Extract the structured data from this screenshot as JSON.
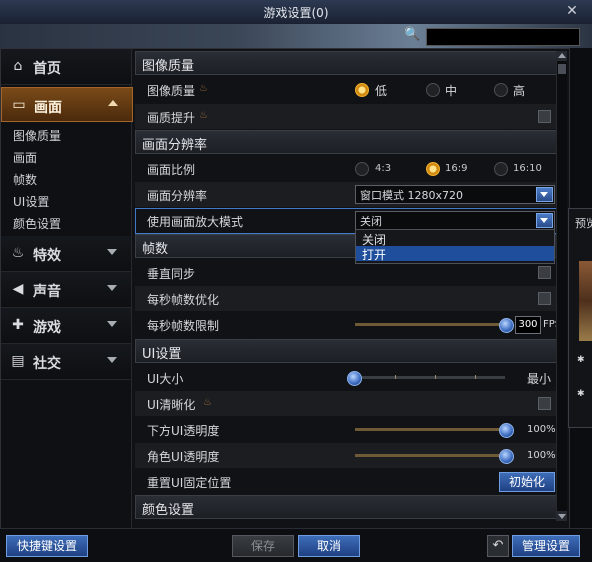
{
  "window": {
    "title": "游戏设置(0)",
    "close": "✕"
  },
  "sidebar": {
    "items": [
      {
        "label": "首页",
        "icon": "home-icon",
        "glyph": "⌂"
      },
      {
        "label": "画面",
        "icon": "monitor-icon",
        "glyph": "▭"
      },
      {
        "label": "特效",
        "icon": "flame-icon",
        "glyph": "♨"
      },
      {
        "label": "声音",
        "icon": "speaker-icon",
        "glyph": "◀"
      },
      {
        "label": "游戏",
        "icon": "gamepad-icon",
        "glyph": "✚"
      },
      {
        "label": "社交",
        "icon": "chat-icon",
        "glyph": "▤"
      }
    ],
    "subitems": [
      "图像质量",
      "画面",
      "帧数",
      "UI设置",
      "颜色设置"
    ]
  },
  "sections": {
    "image_quality": "图像质量",
    "resolution": "画面分辨率",
    "framerate": "帧数",
    "ui": "UI设置",
    "color": "颜色设置"
  },
  "rows": {
    "image_quality": {
      "label": "图像质量",
      "options": [
        "低",
        "中",
        "高"
      ],
      "selected": "低"
    },
    "quality_boost": {
      "label": "画质提升"
    },
    "aspect": {
      "label": "画面比例",
      "options": [
        "4:3",
        "16:9",
        "16:10"
      ],
      "selected": "16:9"
    },
    "resolution": {
      "label": "画面分辨率",
      "value": "窗口模式 1280x720"
    },
    "zoom_mode": {
      "label": "使用画面放大模式",
      "value": "关闭",
      "options": [
        "关闭",
        "打开"
      ],
      "highlighted": "打开"
    },
    "vsync": {
      "label": "垂直同步"
    },
    "fps_opt": {
      "label": "每秒帧数优化"
    },
    "fps_limit": {
      "label": "每秒帧数限制",
      "value": "300",
      "unit": "FPS",
      "level": 1.0
    },
    "ui_size": {
      "label": "UI大小",
      "value_label": "最小",
      "level": 0.0
    },
    "ui_sharpen": {
      "label": "UI清晰化"
    },
    "bottom_ui_opacity": {
      "label": "下方UI透明度",
      "value": "100%",
      "level": 1.0
    },
    "char_ui_opacity": {
      "label": "角色UI透明度",
      "value": "100%",
      "level": 1.0
    },
    "reset_ui_pos": {
      "label": "重置UI固定位置",
      "button": "初始化"
    }
  },
  "bottom": {
    "shortcut": "快捷键设置",
    "save": "保存",
    "cancel": "取消",
    "manage": "管理设置",
    "undo_glyph": "↶"
  },
  "preview": {
    "label": "预览"
  },
  "colors": {
    "accent": "#d28a10",
    "select_blue": "#1f4f9c",
    "active_nav": "#7a4a18"
  }
}
